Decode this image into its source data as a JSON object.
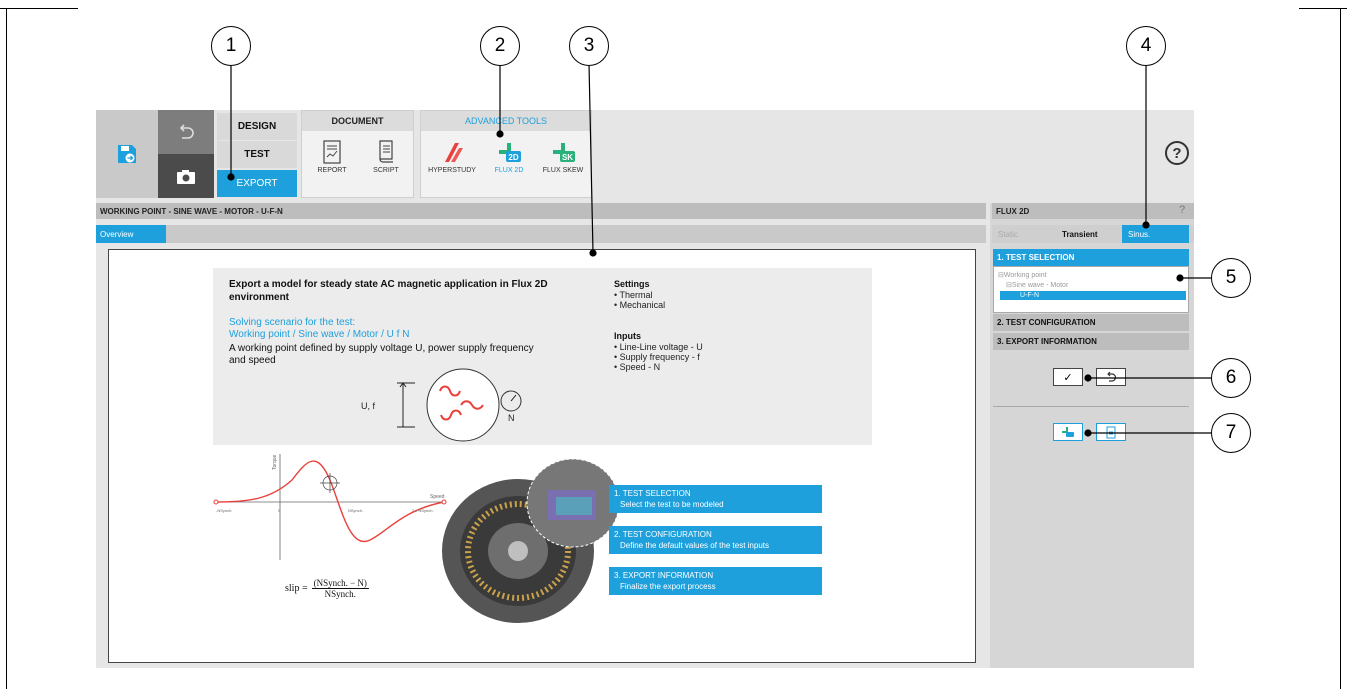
{
  "toolbar": {
    "modes": {
      "design": "DESIGN",
      "test": "TEST",
      "export": "EXPORT"
    },
    "document": {
      "title": "DOCUMENT",
      "report": "REPORT",
      "script": "SCRIPT"
    },
    "advanced": {
      "title": "ADVANCED TOOLS",
      "hyperstudy": "HYPERSTUDY",
      "flux2d": "FLUX 2D",
      "fluxskew": "FLUX SKEW"
    },
    "help": "?"
  },
  "main": {
    "title": "WORKING POINT - SINE WAVE - MOTOR - U-F-N",
    "tab": "Overview",
    "heading": "Export a model for steady state AC magnetic application in Flux 2D environment",
    "scenario_label": "Solving scenario for the test:",
    "scenario_path": "Working point / Sine wave / Motor / U f N",
    "description": "A working point defined by supply voltage U, power supply frequency and speed",
    "settings_title": "Settings",
    "settings": [
      "Thermal",
      "Mechanical"
    ],
    "inputs_title": "Inputs",
    "inputs": [
      "Line-Line voltage - U",
      "Supply frequency - f",
      "Speed - N"
    ],
    "diagram": {
      "uf": "U, f",
      "n": "N"
    },
    "plot": {
      "ylabel": "Torque",
      "xlabel": "Speed",
      "neg_sync": "-NSynch.",
      "zero": "0",
      "sync": "NSynch.",
      "two_sync": "2 x NSynch."
    },
    "slip_formula": {
      "lhs": "slip =",
      "num": "(NSynch. − N)",
      "den": "NSynch."
    },
    "steps": [
      {
        "title": "1. TEST SELECTION",
        "text": "Select the test to be modeled"
      },
      {
        "title": "2. TEST CONFIGURATION",
        "text": "Define the default values of the test inputs"
      },
      {
        "title": "3. EXPORT INFORMATION",
        "text": "Finalize the export process"
      }
    ]
  },
  "right_panel": {
    "title": "FLUX 2D",
    "help": "?",
    "tabs": {
      "static": "Static",
      "transient": "Transient",
      "sinus": "Sinus."
    },
    "sections": {
      "s1": "1. TEST SELECTION",
      "s2": "2. TEST CONFIGURATION",
      "s3": "3. EXPORT INFORMATION"
    },
    "tree": {
      "root": "⊟Working point",
      "child": "⊟Sine wave - Motor",
      "leaf": "U-F-N"
    },
    "accept_symbol": "✓"
  },
  "callouts": [
    "1",
    "2",
    "3",
    "4",
    "5",
    "6",
    "7"
  ],
  "colors": {
    "accent": "#1ea0dc",
    "panel": "#e6e6e6"
  }
}
